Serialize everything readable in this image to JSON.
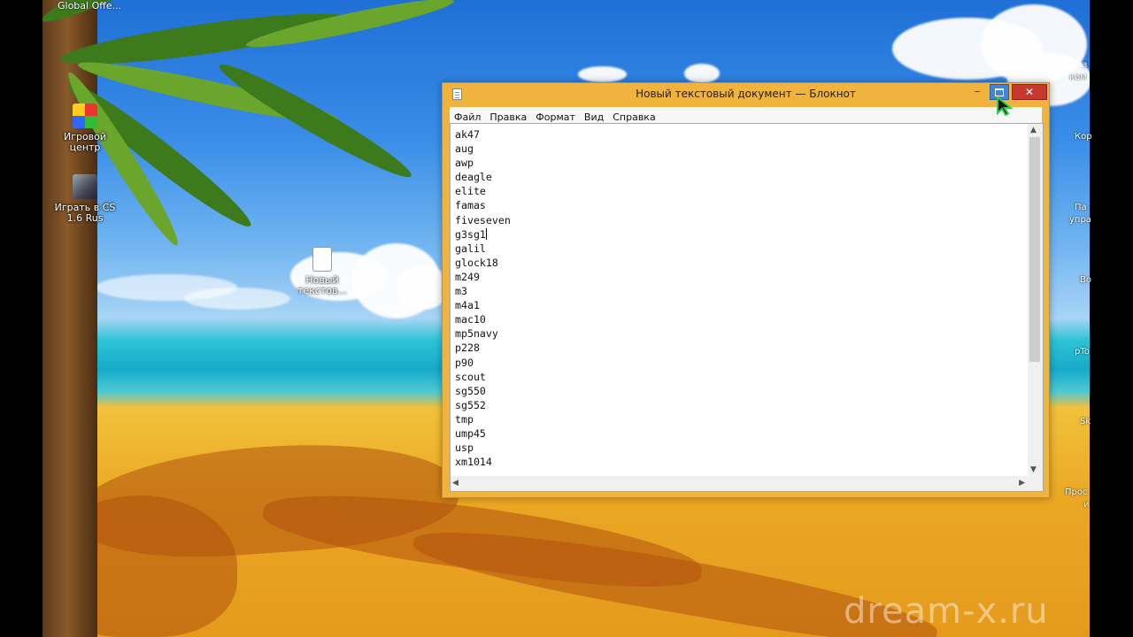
{
  "desktop": {
    "top_left_label": "Global Offe...",
    "icons": [
      {
        "label": "Игровой центр",
        "icon": "game-center-icon"
      },
      {
        "label": "Играть в CS 1.6 Rus",
        "icon": "cs-shortcut-icon"
      },
      {
        "label": "Новый текстов...",
        "icon": "text-document-icon"
      }
    ],
    "right_edge_labels": [
      "з",
      "ком",
      "Кор",
      "Па",
      "упра",
      "Во",
      "pTo",
      "Sk",
      "Прос",
      "и"
    ]
  },
  "window": {
    "title": "Новый текстовый документ — Блокнот",
    "minimize_label": "–",
    "close_label": "✕",
    "menu": [
      "Файл",
      "Правка",
      "Формат",
      "Вид",
      "Справка"
    ],
    "lines": [
      "ak47",
      "aug",
      "awp",
      "deagle",
      "elite",
      "famas",
      "fiveseven",
      "g3sg1",
      "galil",
      "glock18",
      "m249",
      "m3",
      "m4a1",
      "mac10",
      "mp5navy",
      "p228",
      "p90",
      "scout",
      "sg550",
      "sg552",
      "tmp",
      "ump45",
      "usp",
      "xm1014"
    ],
    "caret_line_index": 7
  },
  "watermark": "dream-x.ru",
  "colors": {
    "window_frame": "#f0b33d",
    "close_button": "#c7382e",
    "maximize_button": "#3f86d9"
  }
}
